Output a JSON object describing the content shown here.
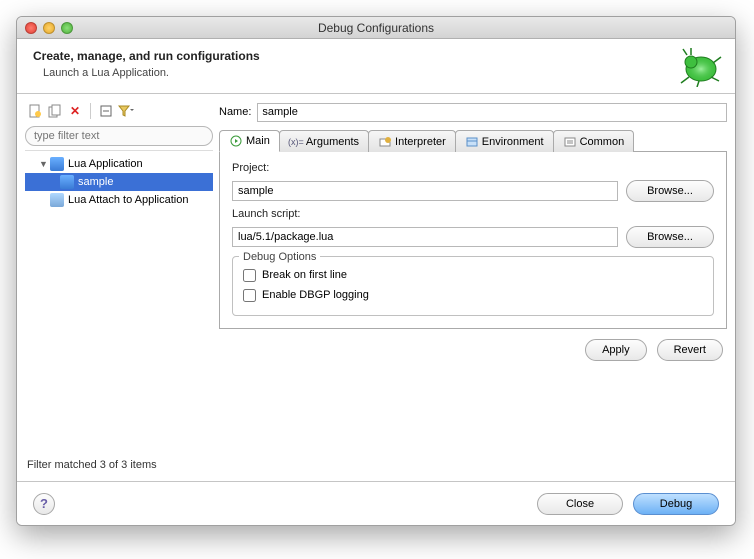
{
  "window": {
    "title": "Debug Configurations"
  },
  "header": {
    "title": "Create, manage, and run configurations",
    "subtitle": "Launch a Lua Application."
  },
  "filter": {
    "placeholder": "type filter text"
  },
  "tree": {
    "items": [
      {
        "label": "Lua Application"
      },
      {
        "label": "sample"
      },
      {
        "label": "Lua Attach to Application"
      }
    ]
  },
  "filter_status": "Filter matched 3 of 3 items",
  "form": {
    "name_label": "Name:",
    "name_value": "sample",
    "tabs": {
      "main": "Main",
      "arguments": "Arguments",
      "interpreter": "Interpreter",
      "environment": "Environment",
      "common": "Common"
    },
    "project_label": "Project:",
    "project_value": "sample",
    "browse": "Browse...",
    "script_label": "Launch script:",
    "script_value": "lua/5.1/package.lua",
    "debug_options_label": "Debug Options",
    "break_first": "Break on first line",
    "dbgp_logging": "Enable DBGP logging"
  },
  "buttons": {
    "apply": "Apply",
    "revert": "Revert",
    "close": "Close",
    "debug": "Debug"
  }
}
